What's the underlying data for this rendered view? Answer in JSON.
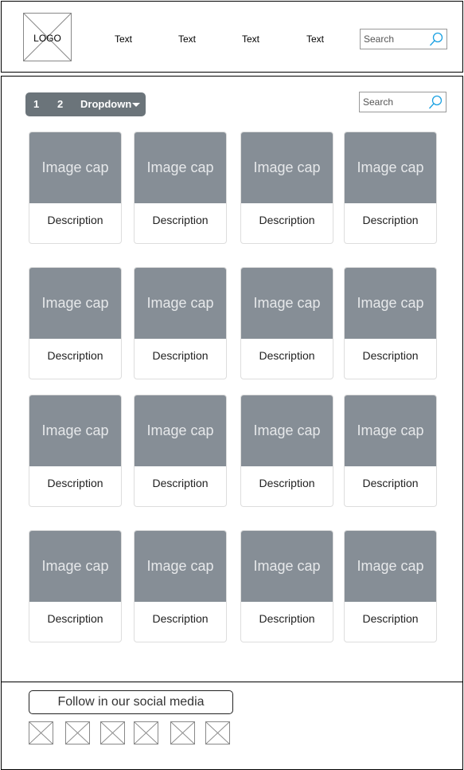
{
  "header": {
    "logo_label": "LOGO",
    "nav": [
      "Text",
      "Text",
      "Text",
      "Text"
    ],
    "search_placeholder": "Search"
  },
  "toolbar": {
    "page_1": "1",
    "page_2": "2",
    "dropdown_label": "Dropdown",
    "search_placeholder": "Search"
  },
  "cards": [
    {
      "cap": "Image cap",
      "desc": "Description"
    },
    {
      "cap": "Image cap",
      "desc": "Description"
    },
    {
      "cap": "Image cap",
      "desc": "Description"
    },
    {
      "cap": "Image cap",
      "desc": "Description"
    },
    {
      "cap": "Image cap",
      "desc": "Description"
    },
    {
      "cap": "Image cap",
      "desc": "Description"
    },
    {
      "cap": "Image cap",
      "desc": "Description"
    },
    {
      "cap": "Image cap",
      "desc": "Description"
    },
    {
      "cap": "Image cap",
      "desc": "Description"
    },
    {
      "cap": "Image cap",
      "desc": "Description"
    },
    {
      "cap": "Image cap",
      "desc": "Description"
    },
    {
      "cap": "Image cap",
      "desc": "Description"
    },
    {
      "cap": "Image cap",
      "desc": "Description"
    },
    {
      "cap": "Image cap",
      "desc": "Description"
    },
    {
      "cap": "Image cap",
      "desc": "Description"
    },
    {
      "cap": "Image cap",
      "desc": "Description"
    }
  ],
  "footer": {
    "follow_label": "Follow in our social media",
    "social_icons": [
      "image-placeholder-icon",
      "image-placeholder-icon",
      "image-placeholder-icon",
      "image-placeholder-icon",
      "image-placeholder-icon",
      "image-placeholder-icon"
    ]
  },
  "colors": {
    "pager_bg": "#6b747a",
    "image_cap_bg": "#868e96",
    "search_icon": "#1ba1e2"
  }
}
